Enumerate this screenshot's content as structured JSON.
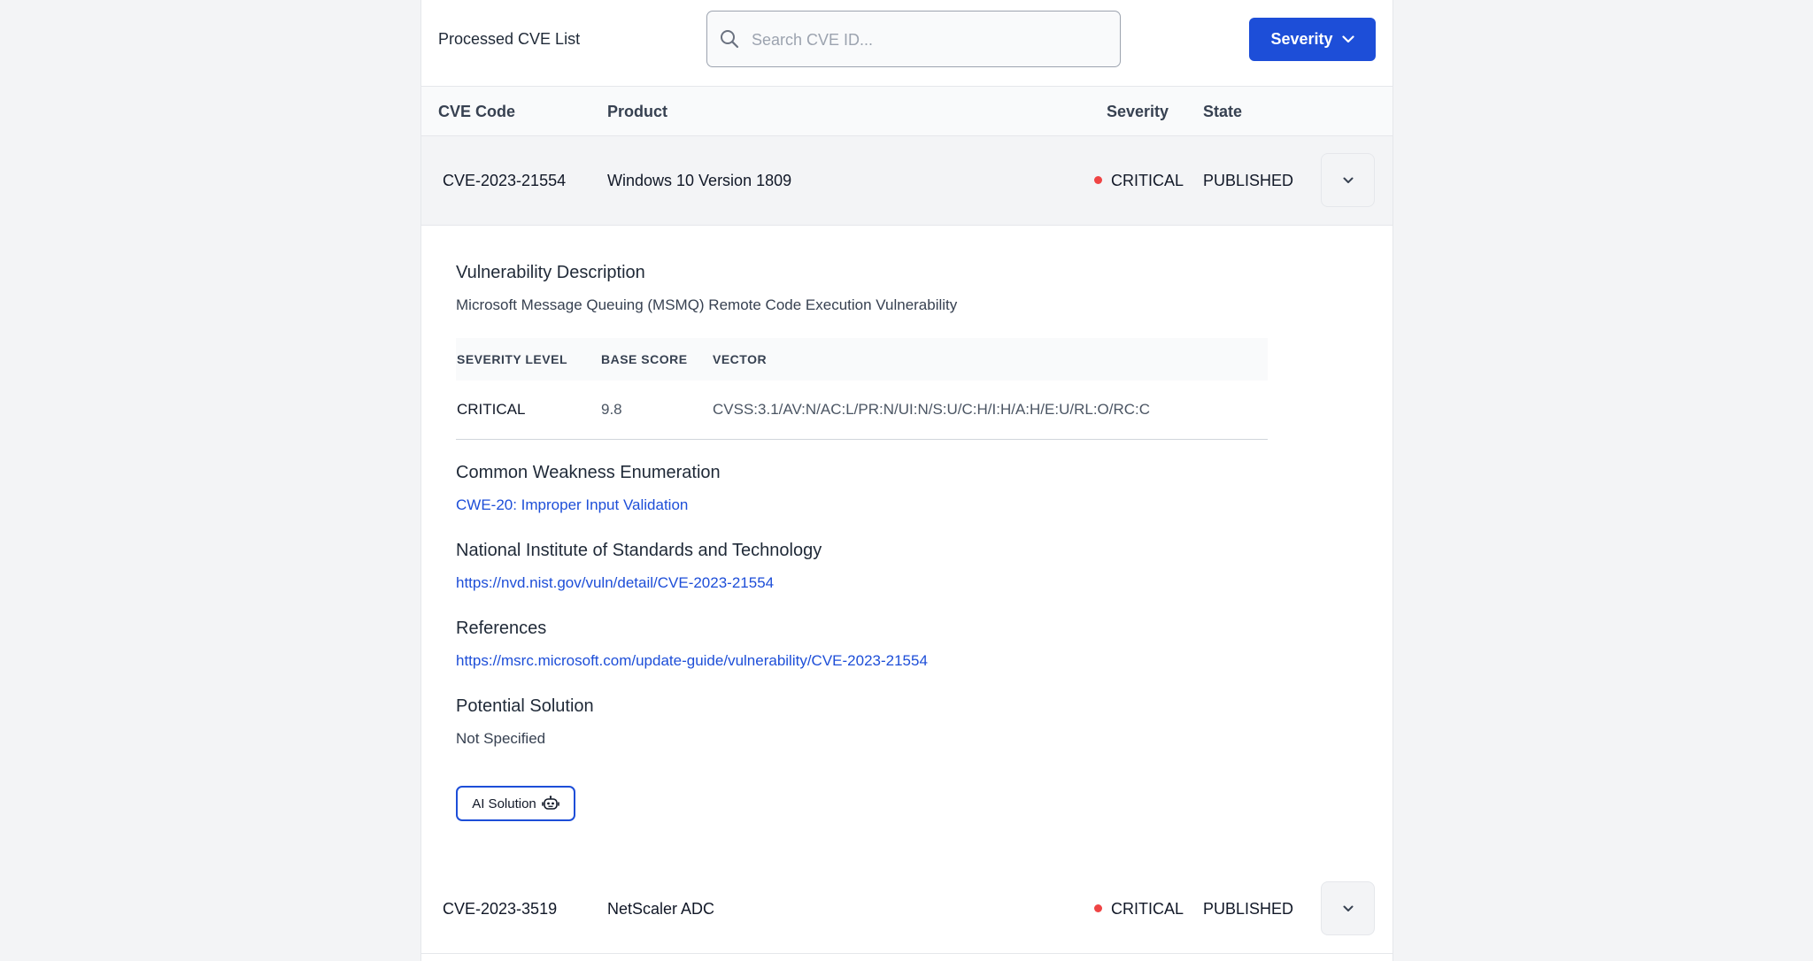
{
  "toolbar": {
    "title": "Processed CVE List",
    "search_placeholder": "Search CVE ID...",
    "severity_filter_label": "Severity"
  },
  "table": {
    "columns": {
      "cve_code": "CVE Code",
      "product": "Product",
      "severity": "Severity",
      "state": "State"
    },
    "rows": [
      {
        "cve_code": "CVE-2023-21554",
        "product": "Windows 10 Version 1809",
        "severity": "CRITICAL",
        "state": "PUBLISHED",
        "expanded": true
      },
      {
        "cve_code": "CVE-2023-3519",
        "product": "NetScaler ADC",
        "severity": "CRITICAL",
        "state": "PUBLISHED",
        "expanded": false
      }
    ]
  },
  "details": {
    "description_title": "Vulnerability Description",
    "description": "Microsoft Message Queuing (MSMQ) Remote Code Execution Vulnerability",
    "metrics": {
      "headers": {
        "severity_level": "SEVERITY LEVEL",
        "base_score": "BASE SCORE",
        "vector": "VECTOR"
      },
      "severity_level": "CRITICAL",
      "base_score": "9.8",
      "vector": "CVSS:3.1/AV:N/AC:L/PR:N/UI:N/S:U/C:H/I:H/A:H/E:U/RL:O/RC:C"
    },
    "cwe_title": "Common Weakness Enumeration",
    "cwe_link": "CWE-20: Improper Input Validation",
    "nist_title": "National Institute of Standards and Technology",
    "nist_link": "https://nvd.nist.gov/vuln/detail/CVE-2023-21554",
    "references_title": "References",
    "references_link": "https://msrc.microsoft.com/update-guide/vulnerability/CVE-2023-21554",
    "solution_title": "Potential Solution",
    "solution_text": "Not Specified",
    "ai_button_label": "AI Solution"
  },
  "icons": {
    "search": "search-icon",
    "severity_dropdown": "chevron-down-icon",
    "row_toggle": "chevron-down-icon",
    "ai": "robot-icon"
  },
  "colors": {
    "accent": "#1d4ed8",
    "critical_dot": "#ef4444",
    "page_background": "#f3f4f6"
  }
}
